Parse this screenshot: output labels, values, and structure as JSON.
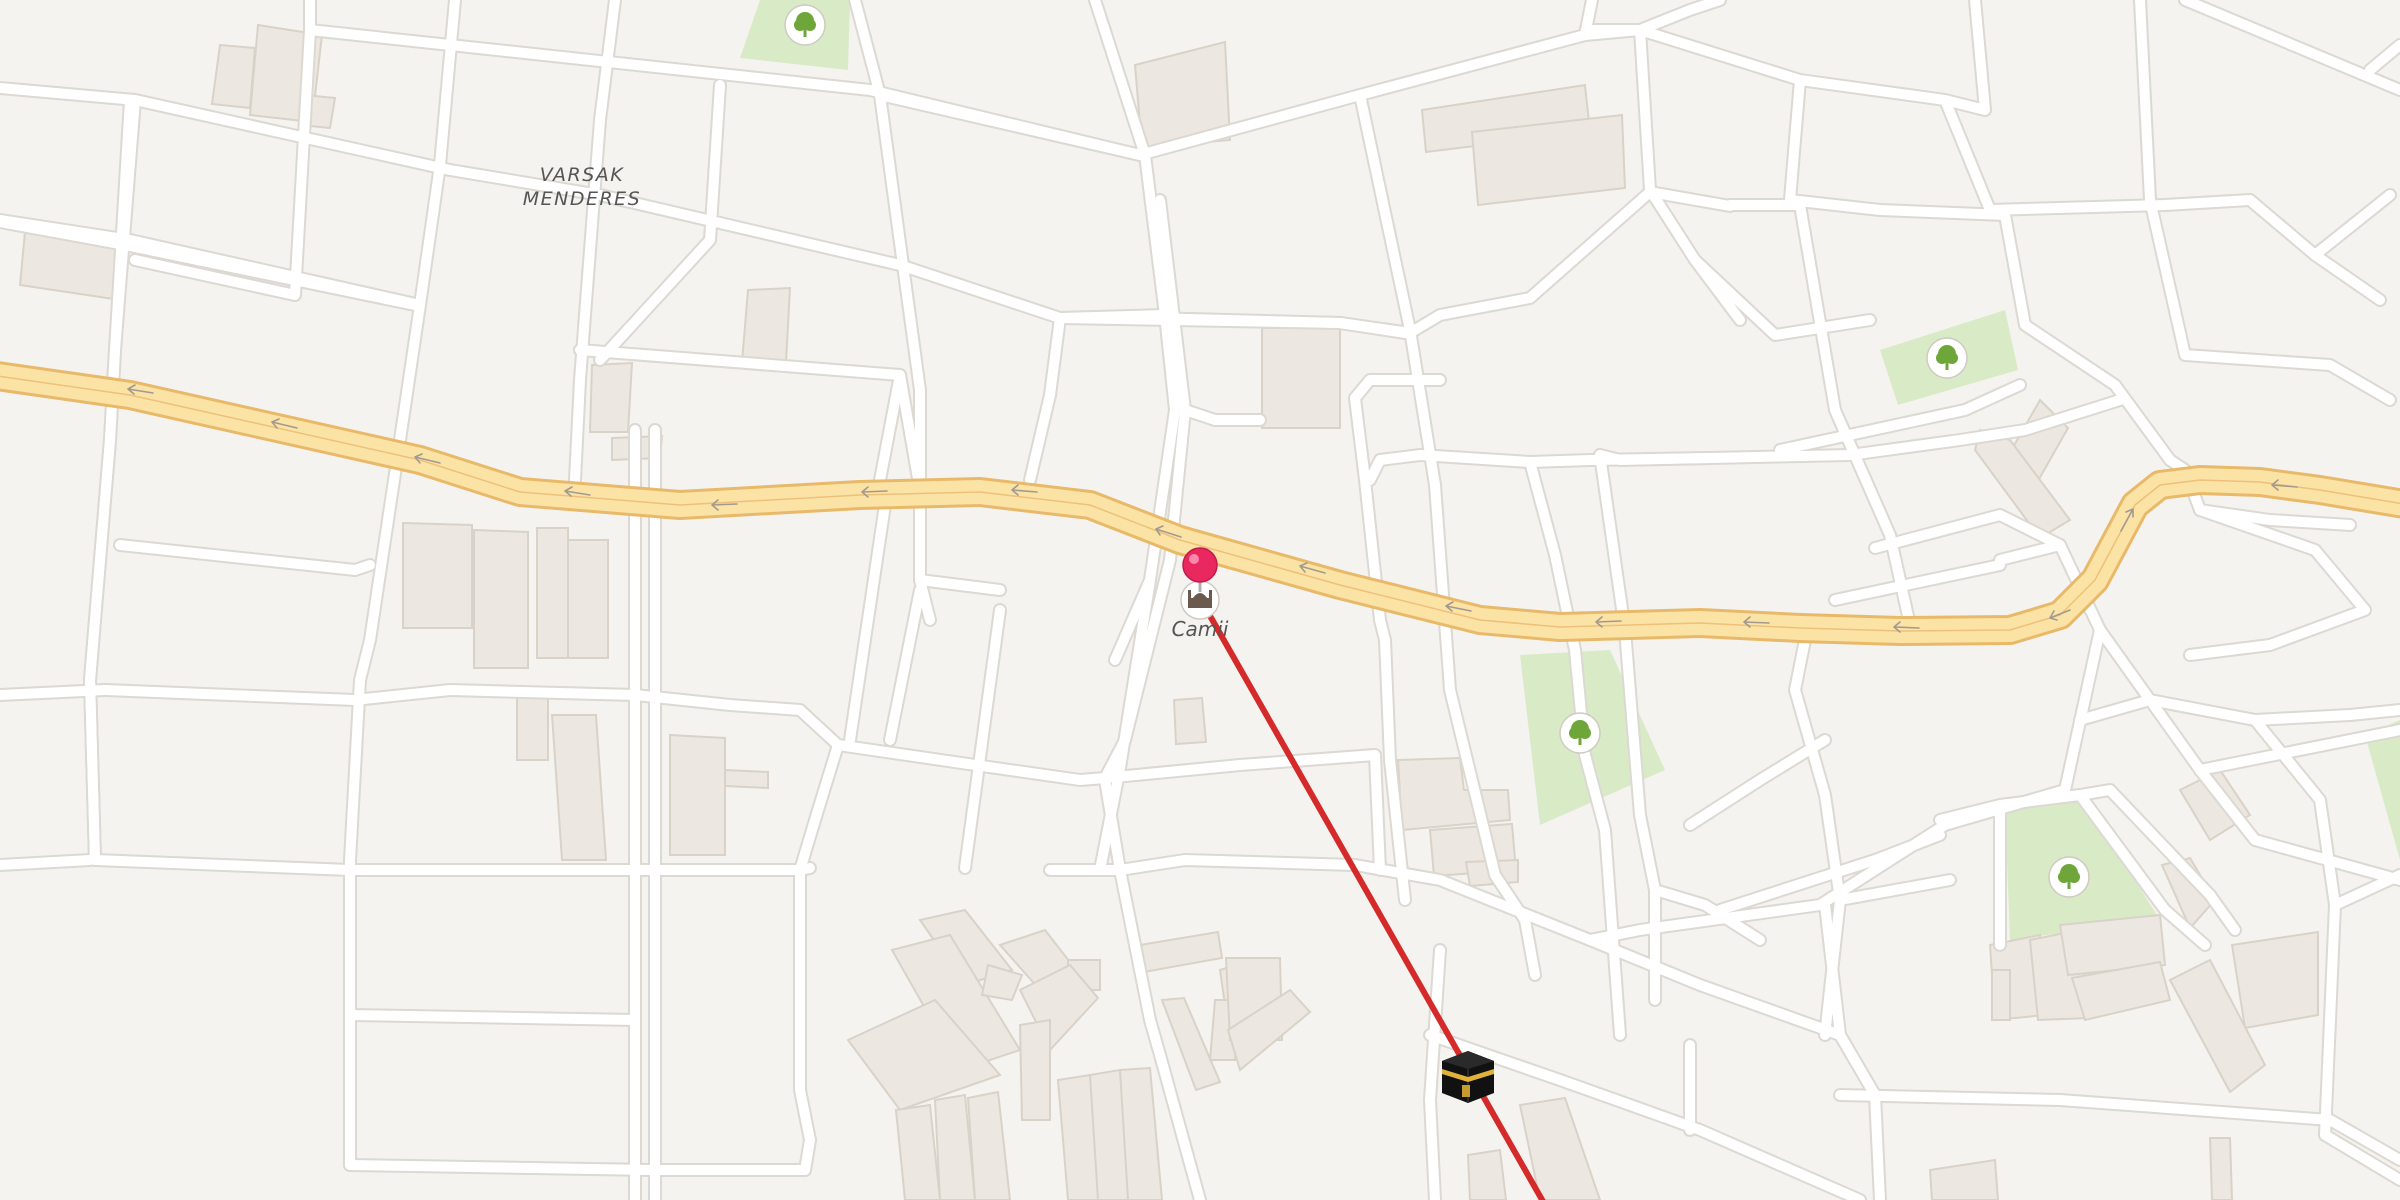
{
  "map": {
    "neighborhood_label_line1": "VARSAK",
    "neighborhood_label_line2": "MENDERES",
    "poi_label": "Camii",
    "colors": {
      "background": "#f5f3f0",
      "road": "#ffffff",
      "road_edge": "#dcd8d2",
      "highway_fill": "#fbe3a6",
      "highway_edge": "#e9b96a",
      "building": "#ece7e0",
      "building_edge": "#d9d2c8",
      "park": "#d8ebc6",
      "pin": "#e8285f",
      "qibla_line": "#d42a2a"
    },
    "icons": [
      "tree-icon",
      "mosque-icon",
      "kaaba-icon",
      "pin-icon",
      "arrow-icon"
    ]
  }
}
